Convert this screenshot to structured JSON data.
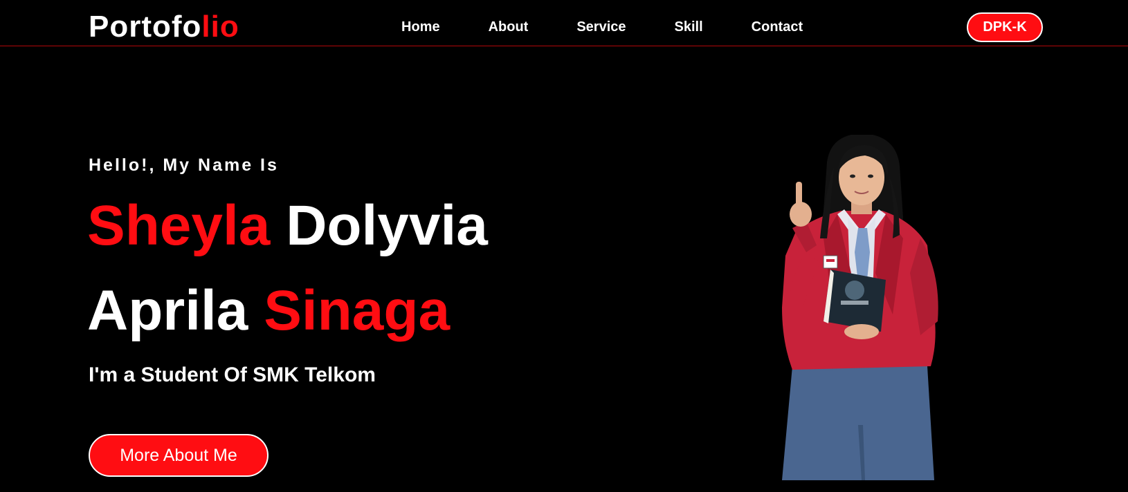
{
  "header": {
    "logo_part1": "Portofo",
    "logo_part2": "lio",
    "nav": {
      "home": "Home",
      "about": "About",
      "service": "Service",
      "skill": "Skill",
      "contact": "Contact"
    },
    "cta_label": "DPK-K"
  },
  "hero": {
    "greeting": "Hello!, My Name Is",
    "name": {
      "first": "Sheyla",
      "second": "Dolyvia",
      "third": "Aprila",
      "fourth": "Sinaga"
    },
    "subtitle": "I'm a Student Of SMK Telkom",
    "button_label": "More About Me"
  },
  "colors": {
    "accent": "#ff0d12",
    "background": "#000000",
    "text": "#ffffff"
  }
}
